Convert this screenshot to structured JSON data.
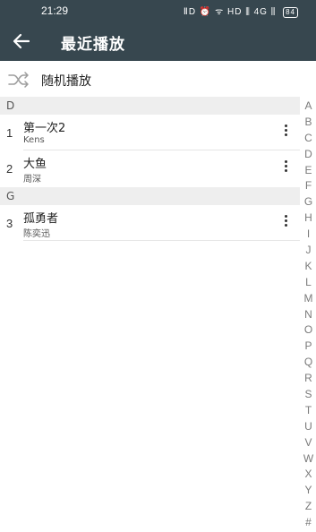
{
  "status_bar": {
    "time": "21:29",
    "icons_text": "ⅡD ⏰ ᯤ HD ⫼ 4G ⫼",
    "battery": "84"
  },
  "header": {
    "title": "最近播放",
    "background": "#37474f"
  },
  "shuffle": {
    "label": "随机播放"
  },
  "sections": [
    {
      "letter": "D",
      "songs": [
        {
          "index": "1",
          "title": "第一次2",
          "artist": "Kens"
        },
        {
          "index": "2",
          "title": "大鱼",
          "artist": "周深"
        }
      ]
    },
    {
      "letter": "G",
      "songs": [
        {
          "index": "3",
          "title": "孤勇者",
          "artist": "陈奕迅"
        }
      ]
    }
  ],
  "index_letters": [
    "A",
    "B",
    "C",
    "D",
    "E",
    "F",
    "G",
    "H",
    "I",
    "J",
    "K",
    "L",
    "M",
    "N",
    "O",
    "P",
    "Q",
    "R",
    "S",
    "T",
    "U",
    "V",
    "W",
    "X",
    "Y",
    "Z",
    "#"
  ]
}
